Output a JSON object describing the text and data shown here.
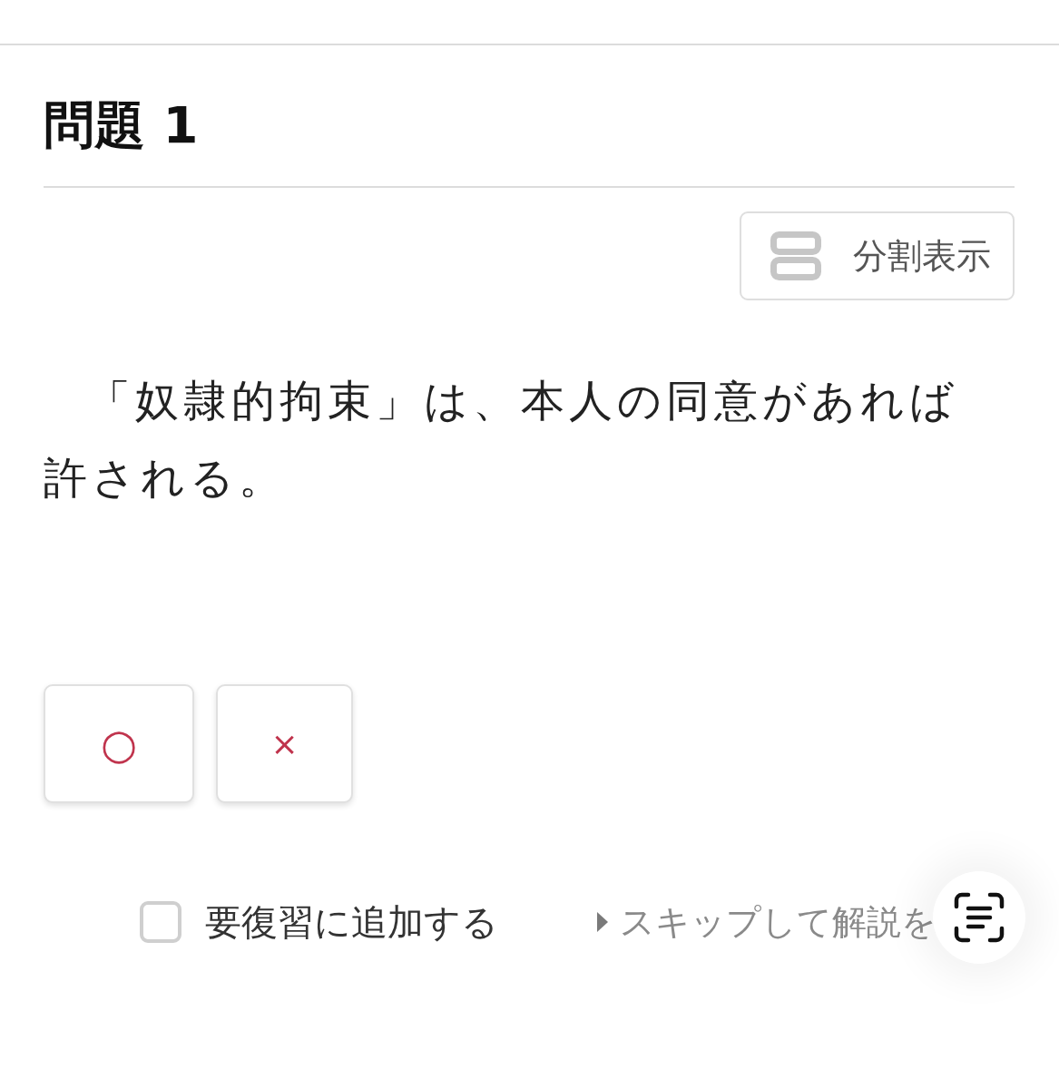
{
  "title": "問題 1",
  "split_view_button": {
    "label": "分割表示"
  },
  "question": {
    "text": "「奴隷的拘束」は、本人の同意があれば許される。"
  },
  "answers": [
    {
      "label": "○",
      "kind": "circle",
      "selected": false
    },
    {
      "label": "×",
      "kind": "cross",
      "selected": false
    }
  ],
  "review_checkbox": {
    "label": "要復習に追加する",
    "checked": false
  },
  "skip_link": {
    "label": "スキップして解説を"
  }
}
